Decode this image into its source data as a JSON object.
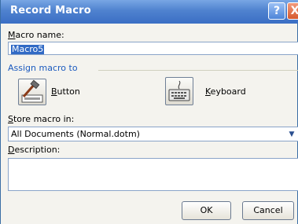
{
  "title": "Record Macro",
  "title_buttons": {
    "help": "?",
    "close": "X"
  },
  "macro_name": {
    "label_prefix": "",
    "label_hot": "M",
    "label_rest": "acro name:",
    "value": "Macro5"
  },
  "assign_macro_to": {
    "label": "Assign macro to"
  },
  "button_option": {
    "hot": "B",
    "rest": "utton"
  },
  "keyboard_option": {
    "hot": "K",
    "rest": "eyboard"
  },
  "store_macro_in": {
    "hot": "S",
    "rest": "tore macro in:",
    "selected": "All Documents (Normal.dotm)"
  },
  "description": {
    "hot": "D",
    "rest": "escription:",
    "value": ""
  },
  "buttons": {
    "ok": "OK",
    "cancel": "Cancel"
  },
  "colors": {
    "titlebar": "#3a6ec4",
    "accent": "#1c5bbf",
    "selection": "#316ac5"
  }
}
